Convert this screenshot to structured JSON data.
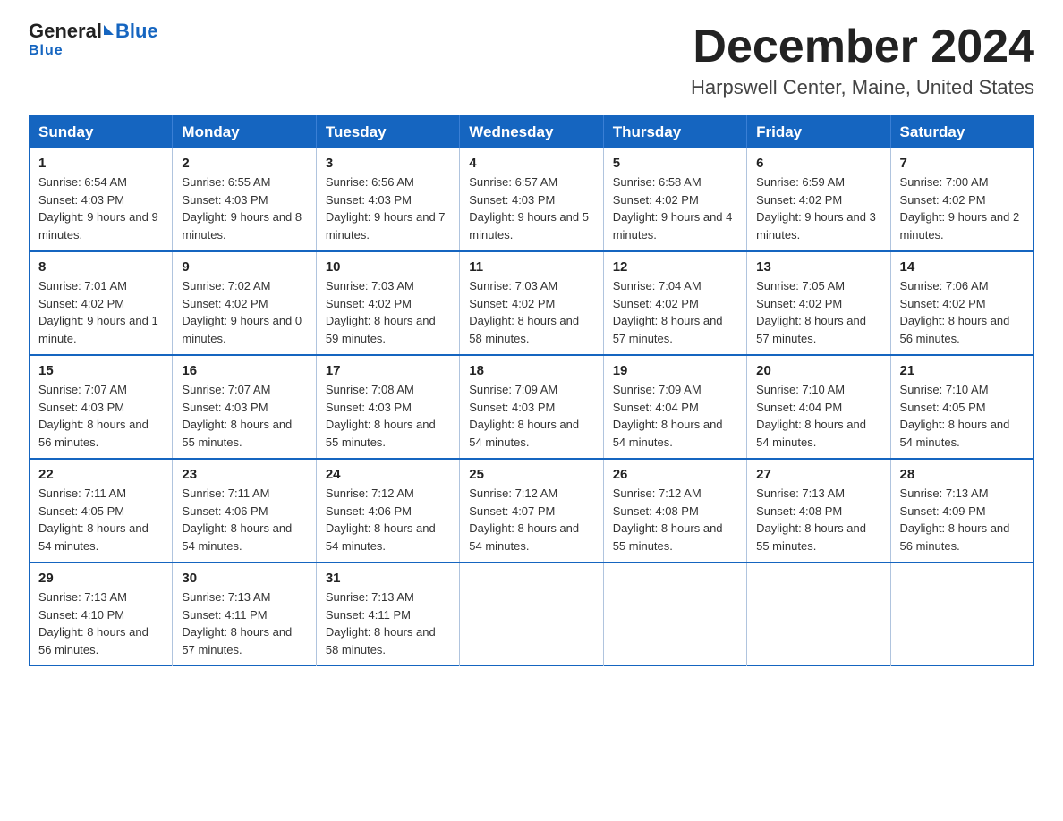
{
  "logo": {
    "general": "General",
    "arrow": "▶",
    "blue": "Blue"
  },
  "title": {
    "month": "December 2024",
    "location": "Harpswell Center, Maine, United States"
  },
  "weekdays": [
    "Sunday",
    "Monday",
    "Tuesday",
    "Wednesday",
    "Thursday",
    "Friday",
    "Saturday"
  ],
  "weeks": [
    [
      {
        "day": "1",
        "sunrise": "Sunrise: 6:54 AM",
        "sunset": "Sunset: 4:03 PM",
        "daylight": "Daylight: 9 hours and 9 minutes."
      },
      {
        "day": "2",
        "sunrise": "Sunrise: 6:55 AM",
        "sunset": "Sunset: 4:03 PM",
        "daylight": "Daylight: 9 hours and 8 minutes."
      },
      {
        "day": "3",
        "sunrise": "Sunrise: 6:56 AM",
        "sunset": "Sunset: 4:03 PM",
        "daylight": "Daylight: 9 hours and 7 minutes."
      },
      {
        "day": "4",
        "sunrise": "Sunrise: 6:57 AM",
        "sunset": "Sunset: 4:03 PM",
        "daylight": "Daylight: 9 hours and 5 minutes."
      },
      {
        "day": "5",
        "sunrise": "Sunrise: 6:58 AM",
        "sunset": "Sunset: 4:02 PM",
        "daylight": "Daylight: 9 hours and 4 minutes."
      },
      {
        "day": "6",
        "sunrise": "Sunrise: 6:59 AM",
        "sunset": "Sunset: 4:02 PM",
        "daylight": "Daylight: 9 hours and 3 minutes."
      },
      {
        "day": "7",
        "sunrise": "Sunrise: 7:00 AM",
        "sunset": "Sunset: 4:02 PM",
        "daylight": "Daylight: 9 hours and 2 minutes."
      }
    ],
    [
      {
        "day": "8",
        "sunrise": "Sunrise: 7:01 AM",
        "sunset": "Sunset: 4:02 PM",
        "daylight": "Daylight: 9 hours and 1 minute."
      },
      {
        "day": "9",
        "sunrise": "Sunrise: 7:02 AM",
        "sunset": "Sunset: 4:02 PM",
        "daylight": "Daylight: 9 hours and 0 minutes."
      },
      {
        "day": "10",
        "sunrise": "Sunrise: 7:03 AM",
        "sunset": "Sunset: 4:02 PM",
        "daylight": "Daylight: 8 hours and 59 minutes."
      },
      {
        "day": "11",
        "sunrise": "Sunrise: 7:03 AM",
        "sunset": "Sunset: 4:02 PM",
        "daylight": "Daylight: 8 hours and 58 minutes."
      },
      {
        "day": "12",
        "sunrise": "Sunrise: 7:04 AM",
        "sunset": "Sunset: 4:02 PM",
        "daylight": "Daylight: 8 hours and 57 minutes."
      },
      {
        "day": "13",
        "sunrise": "Sunrise: 7:05 AM",
        "sunset": "Sunset: 4:02 PM",
        "daylight": "Daylight: 8 hours and 57 minutes."
      },
      {
        "day": "14",
        "sunrise": "Sunrise: 7:06 AM",
        "sunset": "Sunset: 4:02 PM",
        "daylight": "Daylight: 8 hours and 56 minutes."
      }
    ],
    [
      {
        "day": "15",
        "sunrise": "Sunrise: 7:07 AM",
        "sunset": "Sunset: 4:03 PM",
        "daylight": "Daylight: 8 hours and 56 minutes."
      },
      {
        "day": "16",
        "sunrise": "Sunrise: 7:07 AM",
        "sunset": "Sunset: 4:03 PM",
        "daylight": "Daylight: 8 hours and 55 minutes."
      },
      {
        "day": "17",
        "sunrise": "Sunrise: 7:08 AM",
        "sunset": "Sunset: 4:03 PM",
        "daylight": "Daylight: 8 hours and 55 minutes."
      },
      {
        "day": "18",
        "sunrise": "Sunrise: 7:09 AM",
        "sunset": "Sunset: 4:03 PM",
        "daylight": "Daylight: 8 hours and 54 minutes."
      },
      {
        "day": "19",
        "sunrise": "Sunrise: 7:09 AM",
        "sunset": "Sunset: 4:04 PM",
        "daylight": "Daylight: 8 hours and 54 minutes."
      },
      {
        "day": "20",
        "sunrise": "Sunrise: 7:10 AM",
        "sunset": "Sunset: 4:04 PM",
        "daylight": "Daylight: 8 hours and 54 minutes."
      },
      {
        "day": "21",
        "sunrise": "Sunrise: 7:10 AM",
        "sunset": "Sunset: 4:05 PM",
        "daylight": "Daylight: 8 hours and 54 minutes."
      }
    ],
    [
      {
        "day": "22",
        "sunrise": "Sunrise: 7:11 AM",
        "sunset": "Sunset: 4:05 PM",
        "daylight": "Daylight: 8 hours and 54 minutes."
      },
      {
        "day": "23",
        "sunrise": "Sunrise: 7:11 AM",
        "sunset": "Sunset: 4:06 PM",
        "daylight": "Daylight: 8 hours and 54 minutes."
      },
      {
        "day": "24",
        "sunrise": "Sunrise: 7:12 AM",
        "sunset": "Sunset: 4:06 PM",
        "daylight": "Daylight: 8 hours and 54 minutes."
      },
      {
        "day": "25",
        "sunrise": "Sunrise: 7:12 AM",
        "sunset": "Sunset: 4:07 PM",
        "daylight": "Daylight: 8 hours and 54 minutes."
      },
      {
        "day": "26",
        "sunrise": "Sunrise: 7:12 AM",
        "sunset": "Sunset: 4:08 PM",
        "daylight": "Daylight: 8 hours and 55 minutes."
      },
      {
        "day": "27",
        "sunrise": "Sunrise: 7:13 AM",
        "sunset": "Sunset: 4:08 PM",
        "daylight": "Daylight: 8 hours and 55 minutes."
      },
      {
        "day": "28",
        "sunrise": "Sunrise: 7:13 AM",
        "sunset": "Sunset: 4:09 PM",
        "daylight": "Daylight: 8 hours and 56 minutes."
      }
    ],
    [
      {
        "day": "29",
        "sunrise": "Sunrise: 7:13 AM",
        "sunset": "Sunset: 4:10 PM",
        "daylight": "Daylight: 8 hours and 56 minutes."
      },
      {
        "day": "30",
        "sunrise": "Sunrise: 7:13 AM",
        "sunset": "Sunset: 4:11 PM",
        "daylight": "Daylight: 8 hours and 57 minutes."
      },
      {
        "day": "31",
        "sunrise": "Sunrise: 7:13 AM",
        "sunset": "Sunset: 4:11 PM",
        "daylight": "Daylight: 8 hours and 58 minutes."
      },
      null,
      null,
      null,
      null
    ]
  ]
}
